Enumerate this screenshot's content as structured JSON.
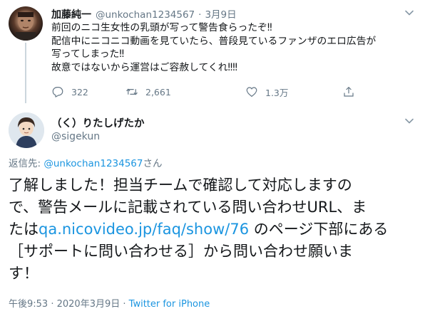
{
  "parent_tweet": {
    "author_name": "加藤純一",
    "author_handle": "@unkochan1234567",
    "separator": "·",
    "date": "3月9日",
    "lines": [
      "前回のニコ生女性の乳頭が写って警告食らったぞ‼",
      "配信中にニコニコ動画を見ていたら、普段見ているファンザのエロ広告が",
      "写ってしまった‼",
      "故意ではないから運営はご容赦してくれ‼‼"
    ],
    "reply_count": "322",
    "retweet_count": "2,661",
    "like_count": "1.3万"
  },
  "main_tweet": {
    "author_name": "（く）りたしげたか",
    "author_handle": "@sigekun",
    "reply_to_prefix": "返信先: ",
    "reply_to_mention": "@unkochan1234567",
    "reply_to_suffix": "さん",
    "line1": "了解しました！担当チームで確認して対応しますの",
    "line2": "で、警告メールに記載されている問い合わせURL、ま",
    "line3_before": "たは",
    "line3_link": "qa.nicovideo.jp/faq/show/76",
    "line3_after": " のページ下部にある",
    "line4": "［サポートに問い合わせる］から問い合わせ願いま",
    "line5": "す！",
    "time": "午後9:53",
    "meta_sep": " · ",
    "date": "2020年3月9日",
    "source": "Twitter for iPhone"
  },
  "colors": {
    "link": "#1b95e0",
    "secondary_text": "#657786",
    "thread_line": "#ccd6dd"
  },
  "icons": [
    "reply-icon",
    "retweet-icon",
    "like-icon",
    "share-icon",
    "caret-down-icon"
  ]
}
